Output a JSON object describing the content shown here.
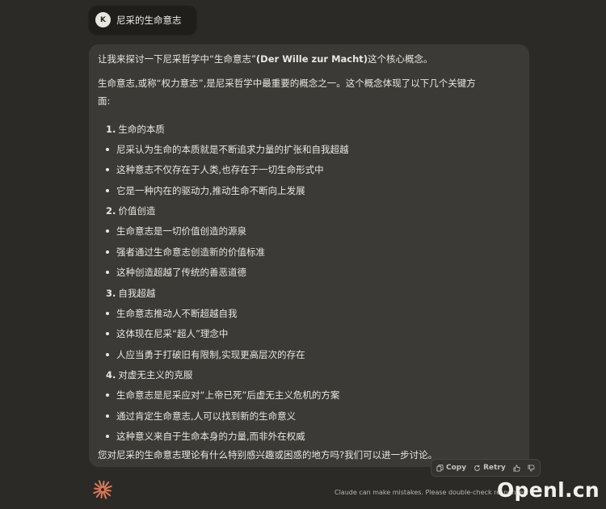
{
  "user_message": {
    "avatar_letter": "K",
    "text": "尼采的生命意志"
  },
  "assistant": {
    "intro_pre": "让我来探讨一下尼采哲学中“生命意志”",
    "intro_bold": "(Der Wille zur Macht)",
    "intro_post": "这个核心概念。",
    "paragraph": "生命意志,或称“权力意志”,是尼采哲学中最重要的概念之一。这个概念体现了以下几个关键方面:",
    "sections": [
      {
        "num": "1.",
        "title": "生命的本质",
        "bullets": [
          "尼采认为生命的本质就是不断追求力量的扩张和自我超越",
          "这种意志不仅存在于人类,也存在于一切生命形式中",
          "它是一种内在的驱动力,推动生命不断向上发展"
        ]
      },
      {
        "num": "2.",
        "title": "价值创造",
        "bullets": [
          "生命意志是一切价值创造的源泉",
          "强者通过生命意志创造新的价值标准",
          "这种创造超越了传统的善恶道德"
        ]
      },
      {
        "num": "3.",
        "title": "自我超越",
        "bullets": [
          "生命意志推动人不断超越自我",
          "这体现在尼采“超人”理念中",
          "人应当勇于打破旧有限制,实现更高层次的存在"
        ]
      },
      {
        "num": "4.",
        "title": "对虚无主义的克服",
        "bullets": [
          "生命意志是尼采应对“上帝已死”后虚无主义危机的方案",
          "通过肯定生命意志,人可以找到新的生命意义",
          "这种意义来自于生命本身的力量,而非外在权威"
        ]
      }
    ],
    "closing": "您对尼采的生命意志理论有什么特别感兴趣或困惑的地方吗?我们可以进一步讨论。"
  },
  "actions": {
    "copy_label": "Copy",
    "retry_label": "Retry"
  },
  "disclaimer": "Claude can make mistakes. Please double-check responses.",
  "watermark": "Openl.cn",
  "colors": {
    "background": "#2b2a27",
    "card": "#3b3a36",
    "user_bubble": "#1f1e1b",
    "logo_accent": "#d97757"
  },
  "icons": [
    "copy-icon",
    "retry-icon",
    "thumbs-up-icon",
    "thumbs-down-icon",
    "claude-logo-icon"
  ]
}
